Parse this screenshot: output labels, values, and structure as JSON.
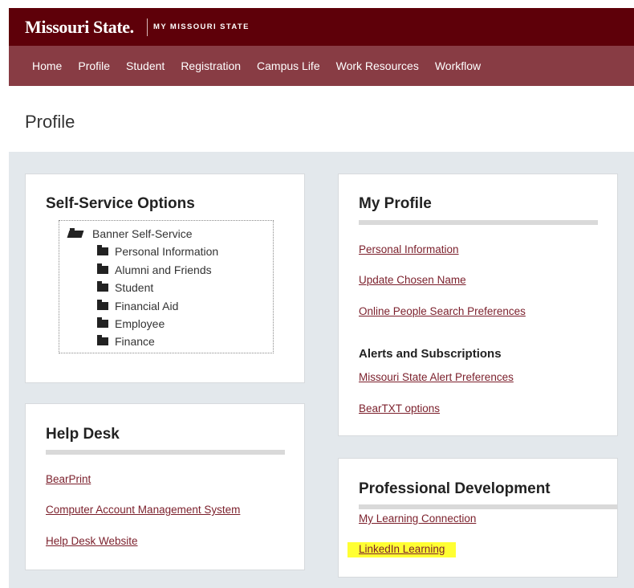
{
  "header": {
    "brand": "Missouri State.",
    "subtitle": "MY MISSOURI STATE"
  },
  "nav": {
    "items": [
      "Home",
      "Profile",
      "Student",
      "Registration",
      "Campus Life",
      "Work Resources",
      "Workflow"
    ]
  },
  "page": {
    "title": "Profile"
  },
  "self_service": {
    "title": "Self-Service Options",
    "root": "Banner Self-Service",
    "children": [
      "Personal Information",
      "Alumni and Friends",
      "Student",
      "Financial Aid",
      "Employee",
      "Finance"
    ]
  },
  "help_desk": {
    "title": "Help Desk",
    "links": [
      "BearPrint",
      "Computer Account Management System",
      "Help Desk Website"
    ]
  },
  "my_profile": {
    "title": "My Profile",
    "links": [
      "Personal Information",
      "Update Chosen Name",
      "Online People Search Preferences"
    ],
    "alerts_heading": "Alerts and Subscriptions",
    "alert_links": [
      "Missouri State Alert Preferences",
      "BearTXT options"
    ]
  },
  "professional_development": {
    "title": "Professional Development",
    "links": [
      "My Learning Connection",
      "LinkedIn Learning"
    ],
    "highlight_color": "#ffff33"
  },
  "colors": {
    "brand_maroon": "#5e0009",
    "nav_maroon": "#883c44",
    "link": "#7b1f2b",
    "background": "#e3e8ec"
  }
}
